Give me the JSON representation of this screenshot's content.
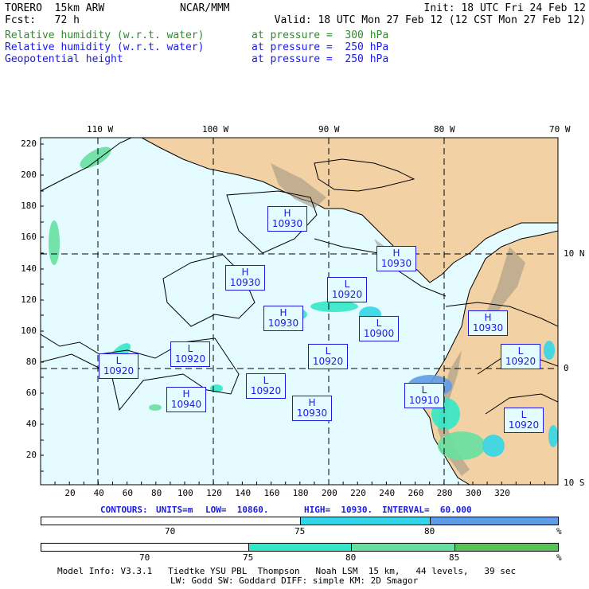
{
  "header": {
    "model": "TORERO  15km ARW",
    "center": "NCAR/MMM",
    "init": "Init: 18 UTC Fri 24 Feb 12",
    "fcst": "Fcst:   72 h",
    "valid": "Valid: 18 UTC Mon 27 Feb 12 (12 CST Mon 27 Feb 12)",
    "fields": [
      {
        "name": "Relative humidity (w.r.t. water)",
        "level": "at pressure =  300 hPa",
        "color": "#2e8b2e"
      },
      {
        "name": "Relative humidity (w.r.t. water)",
        "level": "at pressure =  250 hPa",
        "color": "#1a1ae6"
      },
      {
        "name": "Geopotential height",
        "level": "at pressure =  250 hPa",
        "color": "#1a1ae6"
      }
    ]
  },
  "map": {
    "top_lon_labels": [
      "110 W",
      "100 W",
      "90 W",
      "80 W",
      "70 W"
    ],
    "right_lat_labels": [
      "10 N",
      "0",
      "10 S"
    ],
    "y_ticks": [
      "220",
      "200",
      "180",
      "160",
      "140",
      "120",
      "100",
      "80",
      "60",
      "40",
      "20"
    ],
    "x_ticks": [
      "20",
      "40",
      "60",
      "80",
      "100",
      "120",
      "140",
      "160",
      "180",
      "200",
      "220",
      "240",
      "260",
      "280",
      "300",
      "320"
    ],
    "ocean_color": "#e4fbff",
    "land_color": "#f2d2a4",
    "height_labels": [
      {
        "kind": "H",
        "value": "10930"
      },
      {
        "kind": "H",
        "value": "10930"
      },
      {
        "kind": "H",
        "value": "10930"
      },
      {
        "kind": "L",
        "value": "10920"
      },
      {
        "kind": "H",
        "value": "10930"
      },
      {
        "kind": "L",
        "value": "10900"
      },
      {
        "kind": "H",
        "value": "10930"
      },
      {
        "kind": "L",
        "value": "10920"
      },
      {
        "kind": "L",
        "value": "10920"
      },
      {
        "kind": "L",
        "value": "10920"
      },
      {
        "kind": "L",
        "value": "10920"
      },
      {
        "kind": "L",
        "value": "10920"
      },
      {
        "kind": "H",
        "value": "10940"
      },
      {
        "kind": "L",
        "value": "10910"
      },
      {
        "kind": "H",
        "value": "10930"
      },
      {
        "kind": "L",
        "value": "10920"
      }
    ]
  },
  "contours_line": {
    "contours": "CONTOURS:",
    "units": "UNITS=m",
    "low": "LOW=  10860.",
    "high": "HIGH=  10930.",
    "interval": "INTERVAL=  60.000"
  },
  "colorbar_250": {
    "ticks": [
      "70",
      "75",
      "80"
    ],
    "unit": "%",
    "colors": [
      "#ffffff",
      "#33d6e8",
      "#5e9ce8"
    ]
  },
  "colorbar_300": {
    "ticks": [
      "70",
      "75",
      "80",
      "85"
    ],
    "unit": "%",
    "colors": [
      "#ffffff",
      "#33e8c8",
      "#66e0a0",
      "#55c455"
    ]
  },
  "footer": {
    "line1": "Model Info: V3.3.1   Tiedtke YSU PBL  Thompson   Noah LSM  15 km,   44 levels,   39 sec",
    "line2": "LW: Godd SW: Goddard DIFF: simple KM: 2D Smagor"
  }
}
